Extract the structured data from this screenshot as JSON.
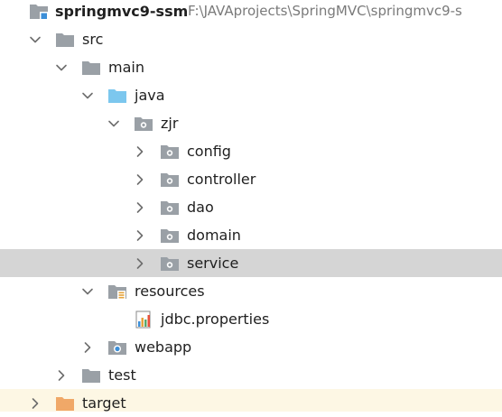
{
  "tree": {
    "root": {
      "label": "springmvc9-ssm",
      "path": "F:\\JAVAprojects\\SpringMVC\\springmvc9-s"
    },
    "src": {
      "label": "src"
    },
    "main": {
      "label": "main"
    },
    "java": {
      "label": "java"
    },
    "zjr": {
      "label": "zjr"
    },
    "config": {
      "label": "config"
    },
    "controller": {
      "label": "controller"
    },
    "dao": {
      "label": "dao"
    },
    "domain": {
      "label": "domain"
    },
    "service": {
      "label": "service"
    },
    "resources": {
      "label": "resources"
    },
    "jdbc": {
      "label": "jdbc.properties"
    },
    "webapp": {
      "label": "webapp"
    },
    "test": {
      "label": "test"
    },
    "target": {
      "label": "target"
    }
  },
  "colors": {
    "folder_gray": "#9aa0a6",
    "folder_blue": "#7cc7ee",
    "folder_orange": "#f0a868",
    "selection": "#d5d5d5"
  }
}
